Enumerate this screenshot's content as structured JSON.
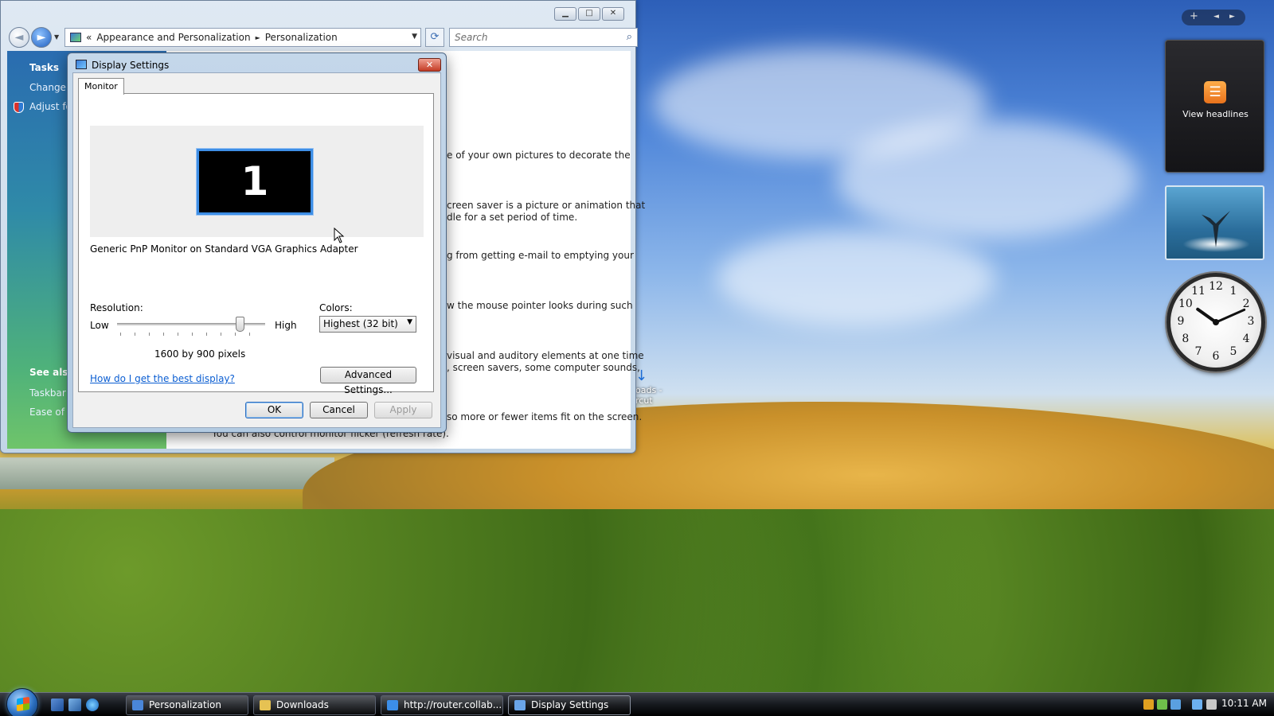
{
  "explorer": {
    "breadcrumb": {
      "overflow": "«",
      "parent": "Appearance and Personalization",
      "separator": "►",
      "current": "Personalization"
    },
    "search_placeholder": "Search",
    "refresh_icon": "refresh-icon",
    "sidebar": {
      "tasks_heading": "Tasks",
      "task_items": [
        "Change d",
        "Adjust fo"
      ],
      "see_also_heading": "See also",
      "see_also_items": [
        "Taskbar a",
        "Ease of A"
      ]
    },
    "content_lines": [
      "e of your own pictures to decorate the",
      "creen saver is a picture or animation that",
      "dle for a set period of time.",
      "g from getting e-mail to emptying your",
      "w the mouse pointer looks during such",
      "visual and auditory elements at one time",
      ", screen savers, some computer sounds,",
      "so more or fewer items fit on the screen.",
      "You can also control monitor flicker (refresh rate)."
    ]
  },
  "dialog": {
    "title": "Display Settings",
    "close_label": "✕",
    "tab_label": "Monitor",
    "monitor_number": "1",
    "monitor_description": "Generic PnP Monitor on Standard VGA Graphics Adapter",
    "resolution_label": "Resolution:",
    "low_label": "Low",
    "high_label": "High",
    "resolution_value": "1600 by 900 pixels",
    "resolution_slider_fraction": 0.83,
    "colors_label": "Colors:",
    "colors_value": "Highest (32 bit)",
    "help_link": "How do I get the best display?",
    "advanced_button": "Advanced Settings...",
    "ok_button": "OK",
    "cancel_button": "Cancel",
    "apply_button": "Apply"
  },
  "desktop": {
    "shortcut_fragment": "oads -\nrcut"
  },
  "gadgets": {
    "toolbar": {
      "add": "+",
      "prev": "◄",
      "next": "►"
    },
    "feed_label": "View headlines",
    "clock_numbers": [
      "12",
      "1",
      "2",
      "3",
      "4",
      "5",
      "6",
      "7",
      "8",
      "9",
      "10",
      "11"
    ]
  },
  "taskbar": {
    "buttons": [
      {
        "label": "Personalization",
        "icon": "control-panel-icon",
        "color": "#4a86d8"
      },
      {
        "label": "Downloads",
        "icon": "folder-icon",
        "color": "#e6c253"
      },
      {
        "label": "http://router.collab...",
        "icon": "ie-icon",
        "color": "#3c8ee8"
      },
      {
        "label": "Display Settings",
        "icon": "display-settings-icon",
        "color": "#6aa5e8"
      }
    ],
    "clock": "10:11 AM"
  }
}
